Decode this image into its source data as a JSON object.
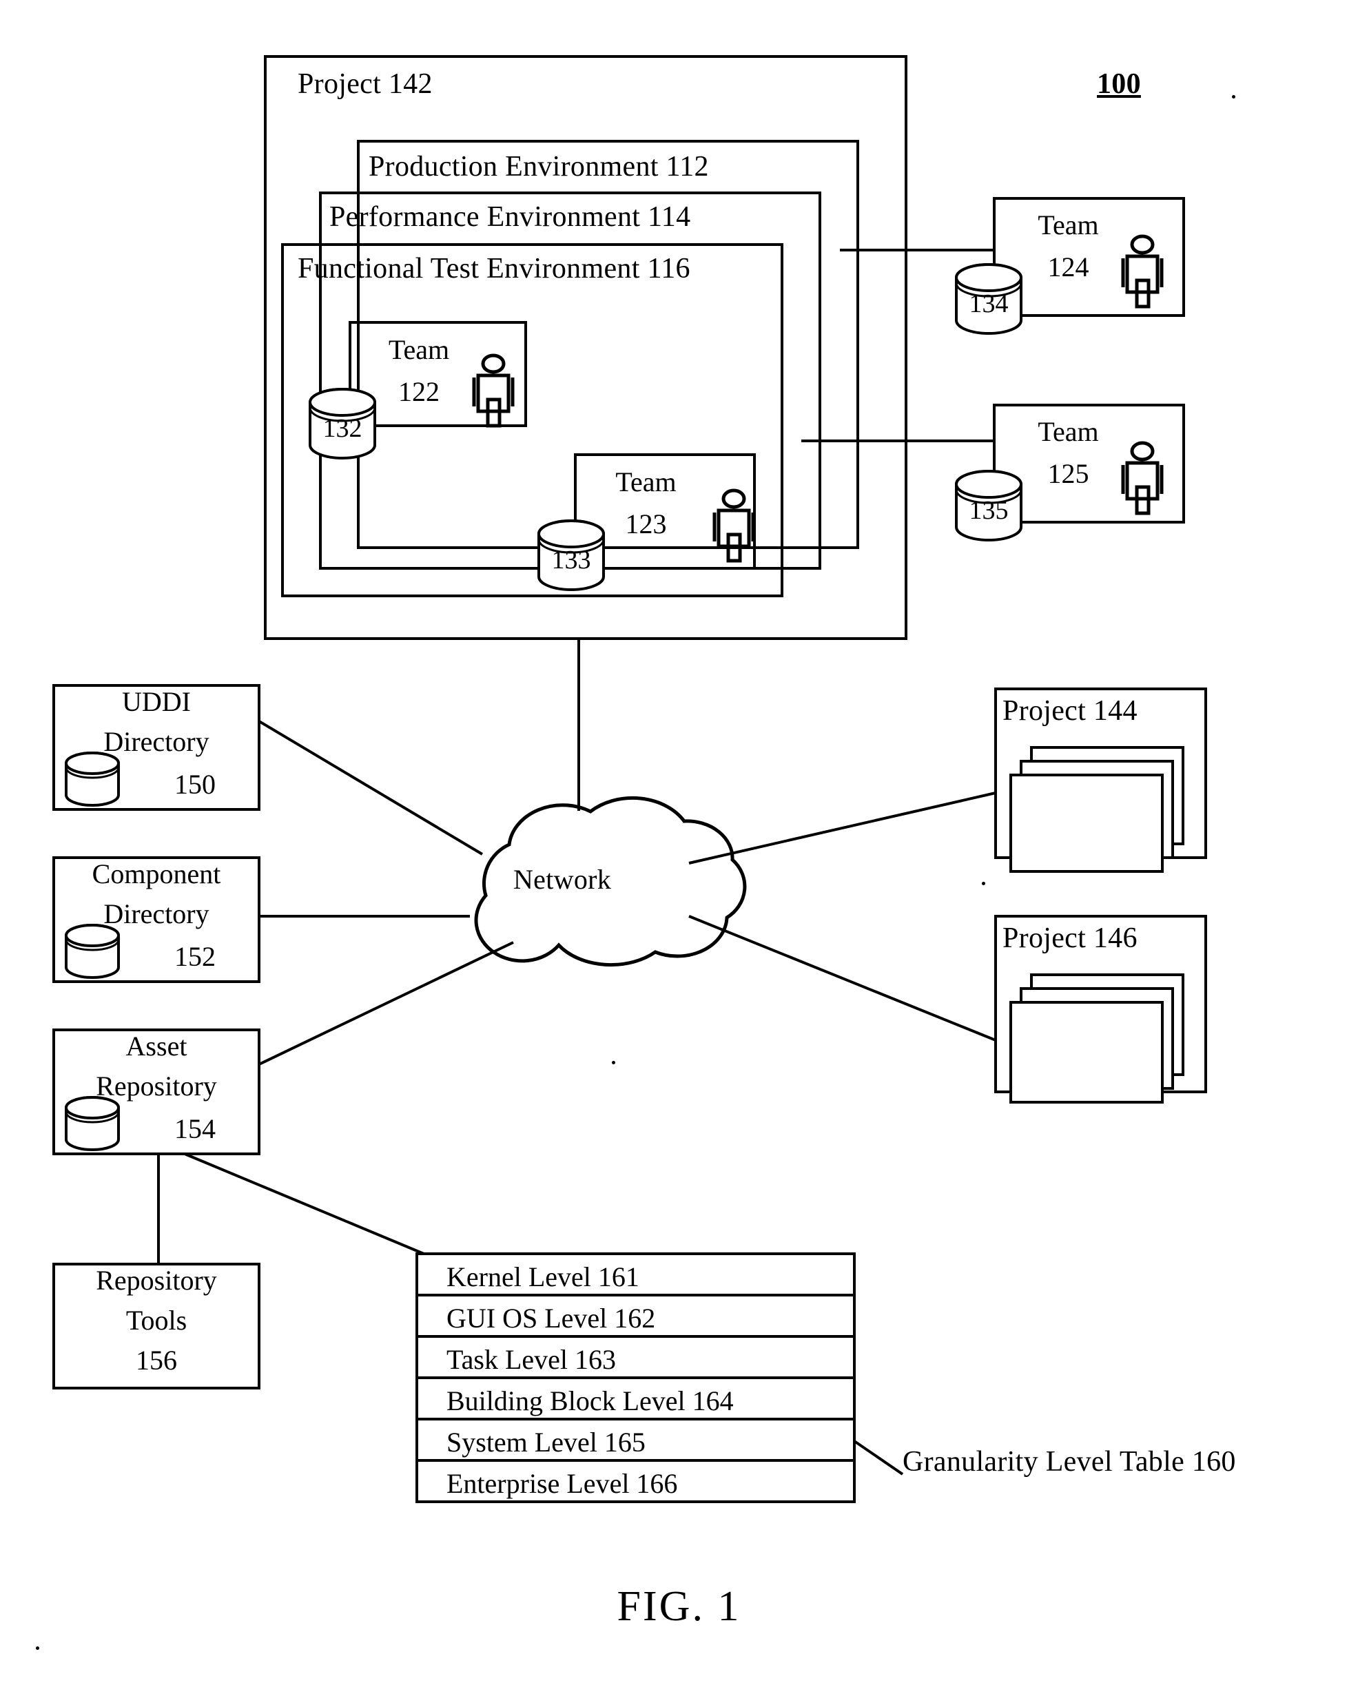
{
  "figure": {
    "caption": "FIG. 1",
    "reference_numeral": "100"
  },
  "project_142": {
    "label": "Project 142",
    "environments": [
      {
        "label": "Production Environment 112",
        "id": "112"
      },
      {
        "label": "Performance Environment 114",
        "id": "114"
      },
      {
        "label": "Functional Test Environment 116",
        "id": "116"
      }
    ],
    "teams": [
      {
        "name": "Team",
        "number": "122",
        "database": "132"
      },
      {
        "name": "Team",
        "number": "123",
        "database": "133"
      }
    ]
  },
  "external_teams": [
    {
      "name": "Team",
      "number": "124",
      "database": "134"
    },
    {
      "name": "Team",
      "number": "125",
      "database": "135"
    }
  ],
  "network": {
    "label": "Network"
  },
  "directories": [
    {
      "line1": "UDDI",
      "line2": "Directory",
      "number": "150",
      "has_cylinder": true
    },
    {
      "line1": "Component",
      "line2": "Directory",
      "number": "152",
      "has_cylinder": true
    },
    {
      "line1": "Asset",
      "line2": "Repository",
      "number": "154",
      "has_cylinder": true
    }
  ],
  "repository_tools": {
    "line1": "Repository",
    "line2": "Tools",
    "line3": "156"
  },
  "other_projects": [
    {
      "label": "Project 144"
    },
    {
      "label": "Project 146"
    }
  ],
  "granularity_table": {
    "callout_label": "Granularity Level Table 160",
    "rows": [
      {
        "label": "Kernel Level 161"
      },
      {
        "label": "GUI OS Level 162"
      },
      {
        "label": "Task Level 163"
      },
      {
        "label": "Building Block Level 164"
      },
      {
        "label": "System Level 165"
      },
      {
        "label": "Enterprise Level 166"
      }
    ]
  },
  "colors": {
    "stroke": "#000000",
    "background": "#ffffff"
  }
}
